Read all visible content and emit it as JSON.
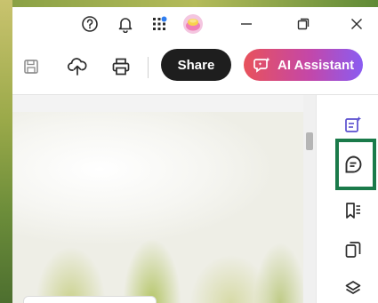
{
  "titlebar": {
    "icons": [
      "help-icon",
      "notifications-bell-icon",
      "apps-grid-icon",
      "profile-avatar-icon",
      "minimize-icon",
      "restore-icon",
      "close-icon"
    ]
  },
  "toolbar": {
    "share_label": "Share",
    "ai_assistant_label": "AI Assistant",
    "icons": [
      "save-icon",
      "cloud-upload-icon",
      "print-icon"
    ]
  },
  "right_rail": {
    "icons": [
      "edit-ai-icon",
      "comment-icon",
      "bookmarks-icon",
      "pages-icon",
      "layers-icon"
    ],
    "active": "comment-icon"
  },
  "colors": {
    "share_bg": "#1e1e1e",
    "ai_gradient_start": "#e8525b",
    "ai_gradient_end": "#8a5cf2",
    "active_highlight": "#1a7a4a",
    "icon_stroke": "#2c2c2c",
    "rail_accent": "#5a4fcf"
  }
}
